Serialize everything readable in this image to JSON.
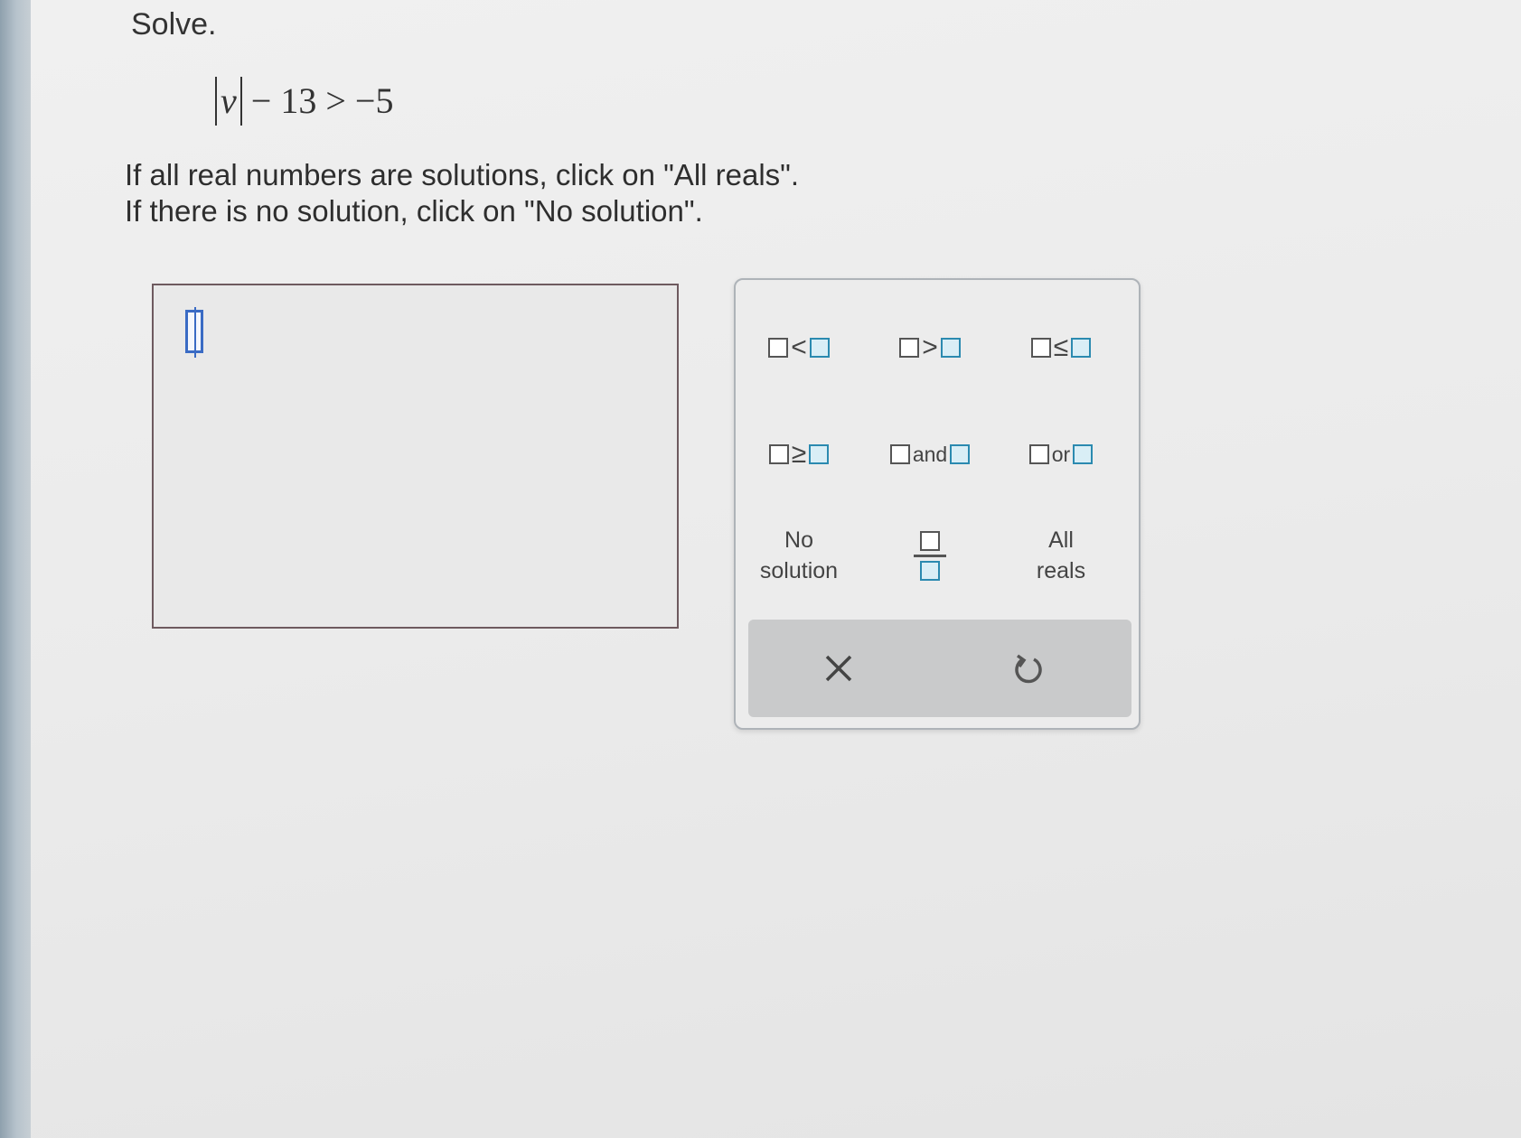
{
  "question": {
    "prompt": "Solve.",
    "equation": {
      "variable": "v",
      "rest": "− 13 > −5"
    },
    "instruction_line1": "If all real numbers are solutions, click on \"All reals\".",
    "instruction_line2": "If there is no solution, click on \"No solution\"."
  },
  "keypad": {
    "less_than": "<",
    "greater_than": ">",
    "less_equal": "≤",
    "greater_equal": "≥",
    "and_label": "and",
    "or_label": "or",
    "no_solution_line1": "No",
    "no_solution_line2": "solution",
    "all_reals_line1": "All",
    "all_reals_line2": "reals"
  },
  "icons": {
    "clear": "close-icon",
    "undo": "undo-icon"
  }
}
